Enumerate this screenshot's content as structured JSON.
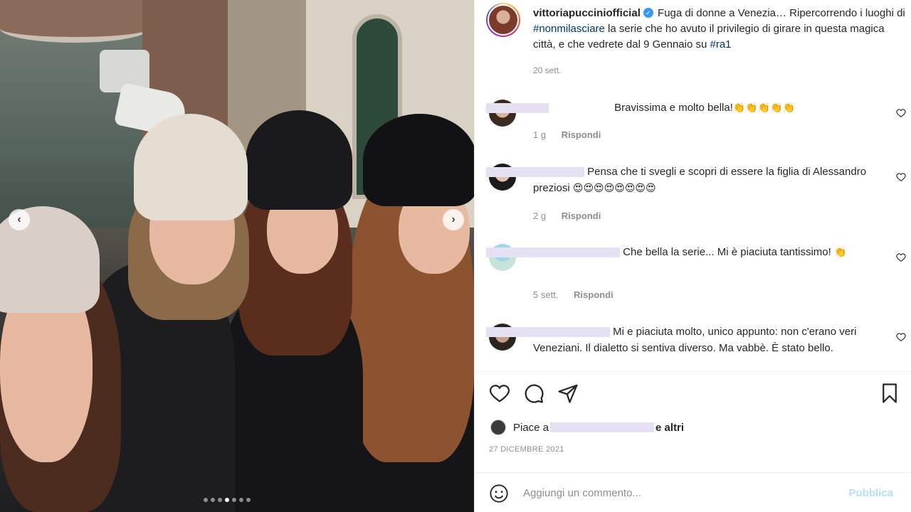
{
  "post": {
    "username": "vittoriapucciniofficial",
    "caption_part1": "Fuga di donne a Venezia… Ripercorrendo i luoghi di ",
    "hashtag1": "#nonmilasciare",
    "caption_part2": " la serie che ho avuto il privilegio di girare in questa magica città, e che vedrete dal 9 Gennaio su ",
    "hashtag2": "#ra1",
    "time": "20 sett."
  },
  "comments": [
    {
      "text": "Bravissima e molto bella!",
      "emoji": "👏👏👏👏👏",
      "time": "1 g",
      "reply": "Rispondi"
    },
    {
      "text": "Pensa che ti svegli e scopri di essere la figlia di Alessandro preziosi ",
      "emoji": "😍😍😍😍😍😍😍😍",
      "time": "2 g",
      "reply": "Rispondi"
    },
    {
      "text": "Che bella la serie... Mi è piaciuta tantissimo! ",
      "emoji": "👏",
      "time": "5 sett.",
      "reply": "Rispondi"
    },
    {
      "text": "Mi e piaciuta molto, unico appunto: non c'erano veri Veneziani. Il dialetto si sentiva diverso. Ma vabbè. È stato bello."
    }
  ],
  "likes": {
    "prefix": "Piace a",
    "suffix": "e altri"
  },
  "date": "27 DICEMBRE 2021",
  "add_comment": {
    "placeholder": "Aggiungi un commento...",
    "post_label": "Pubblica"
  },
  "carousel": {
    "left_arrow": "‹",
    "right_arrow": "›",
    "slides": 7,
    "active": 3
  },
  "icons": [
    "heart-icon",
    "comment-icon",
    "share-icon",
    "bookmark-icon",
    "emoji-icon",
    "verified-icon"
  ],
  "colors": {
    "hashtag": "#00376b",
    "muted": "#8e8e8e",
    "post_disabled": "#b2dffc",
    "verified": "#3897f0"
  }
}
